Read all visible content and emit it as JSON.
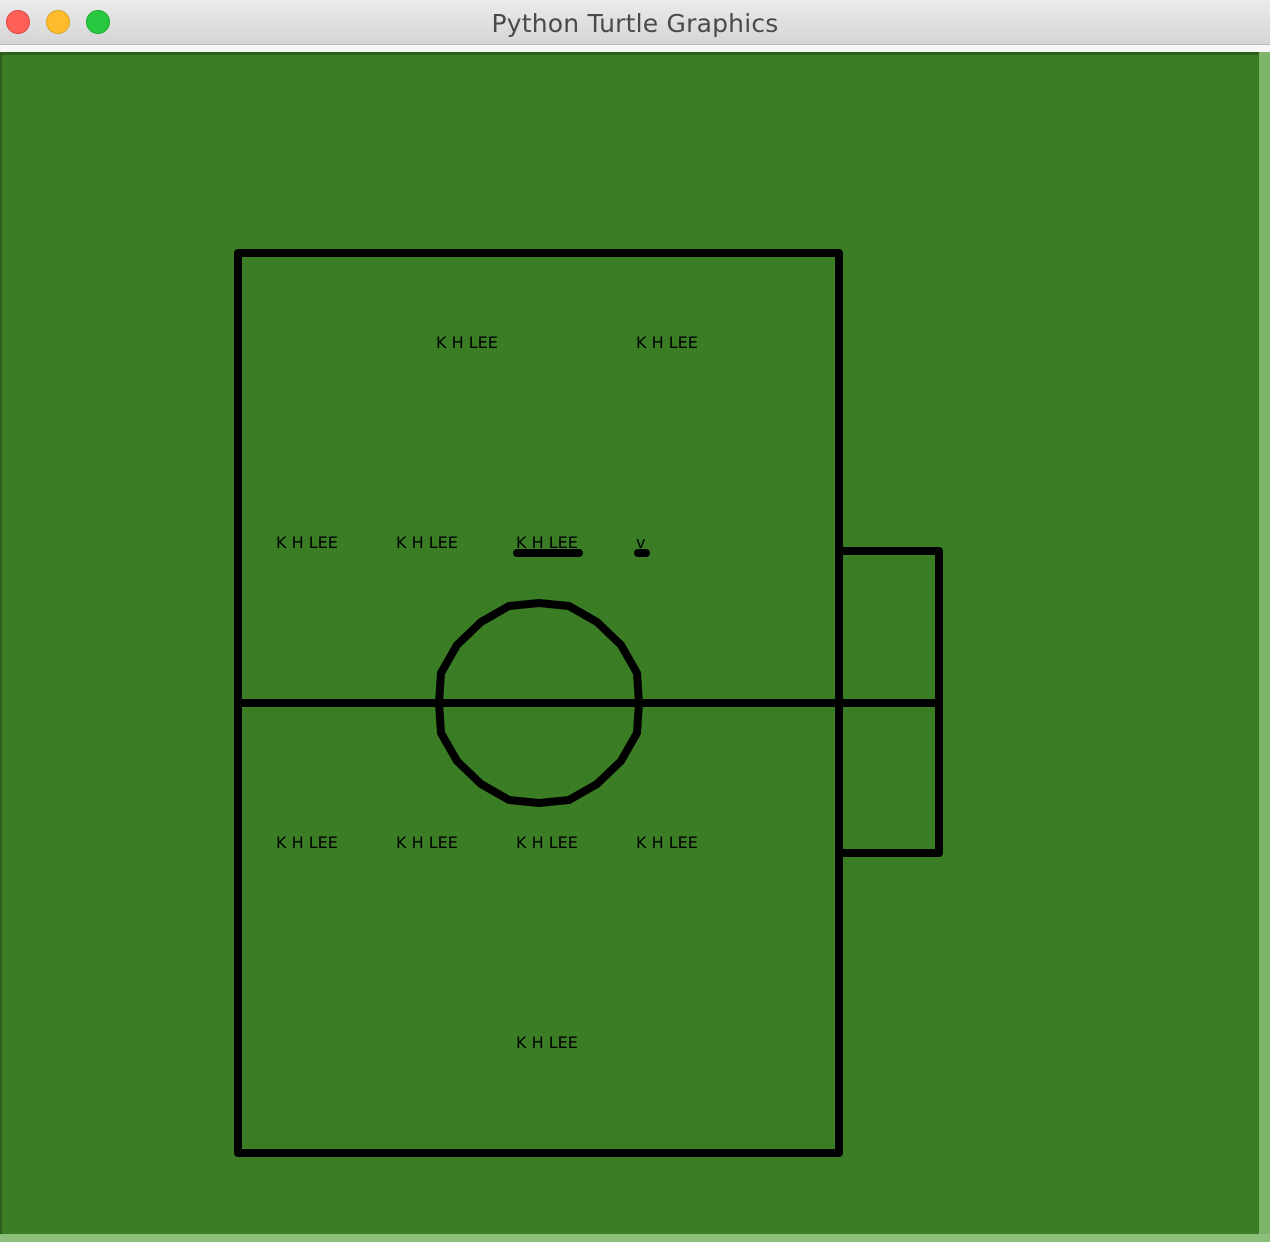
{
  "window": {
    "title": "Python Turtle Graphics",
    "controls": {
      "close": "close-button",
      "minimize": "minimize-button",
      "zoom": "zoom-button"
    }
  },
  "canvas": {
    "background_color": "#3a7d24",
    "line_color": "#000000"
  },
  "players": [
    {
      "label": "K H LEE"
    },
    {
      "label": "K H LEE"
    },
    {
      "label": "K H LEE"
    },
    {
      "label": "K H LEE"
    },
    {
      "label": "K H LEE"
    },
    {
      "label": "v"
    },
    {
      "label": "K H LEE"
    },
    {
      "label": "K H LEE"
    },
    {
      "label": "K H LEE"
    },
    {
      "label": "K H LEE"
    },
    {
      "label": "K H LEE"
    }
  ]
}
